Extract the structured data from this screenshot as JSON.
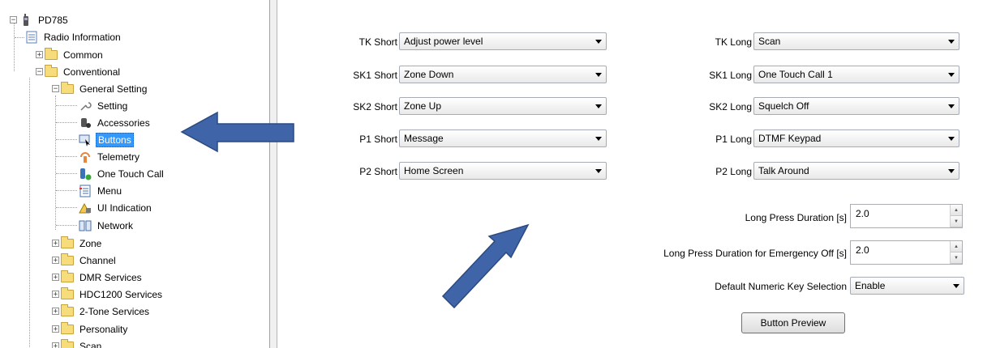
{
  "tree": {
    "root": "PD785",
    "items": [
      {
        "label": "Radio Information",
        "icon": "document-icon"
      },
      {
        "label": "Common",
        "icon": "folder-icon"
      },
      {
        "label": "Conventional",
        "icon": "folder-icon"
      },
      {
        "label": "General Setting",
        "icon": "folder-icon"
      },
      {
        "label": "Setting",
        "icon": "wrench-icon"
      },
      {
        "label": "Accessories",
        "icon": "accessories-icon"
      },
      {
        "label": "Buttons",
        "icon": "buttons-icon",
        "selected": true
      },
      {
        "label": "Telemetry",
        "icon": "telemetry-icon"
      },
      {
        "label": "One Touch Call",
        "icon": "phone-icon"
      },
      {
        "label": "Menu",
        "icon": "menu-icon"
      },
      {
        "label": "UI Indication",
        "icon": "ui-indication-icon"
      },
      {
        "label": "Network",
        "icon": "network-icon"
      },
      {
        "label": "Zone",
        "icon": "folder-icon"
      },
      {
        "label": "Channel",
        "icon": "folder-icon"
      },
      {
        "label": "DMR Services",
        "icon": "folder-icon"
      },
      {
        "label": "HDC1200 Services",
        "icon": "folder-icon"
      },
      {
        "label": "2-Tone Services",
        "icon": "folder-icon"
      },
      {
        "label": "Personality",
        "icon": "folder-icon"
      },
      {
        "label": "Scan",
        "icon": "folder-icon"
      }
    ]
  },
  "form": {
    "short_keys": [
      {
        "label": "TK Short",
        "value": "Adjust power level"
      },
      {
        "label": "SK1 Short",
        "value": "Zone Down"
      },
      {
        "label": "SK2 Short",
        "value": "Zone Up"
      },
      {
        "label": "P1 Short",
        "value": "Message"
      },
      {
        "label": "P2 Short",
        "value": "Home Screen"
      }
    ],
    "long_keys": [
      {
        "label": "TK Long",
        "value": "Scan"
      },
      {
        "label": "SK1 Long",
        "value": "One Touch Call 1"
      },
      {
        "label": "SK2 Long",
        "value": "Squelch Off"
      },
      {
        "label": "P1 Long",
        "value": "DTMF Keypad"
      },
      {
        "label": "P2 Long",
        "value": "Talk Around"
      }
    ],
    "long_press_duration": {
      "label": "Long Press Duration [s]",
      "value": "2.0"
    },
    "long_press_emergency": {
      "label": "Long Press Duration for Emergency Off [s]",
      "value": "2.0"
    },
    "default_numeric_key": {
      "label": "Default Numeric Key Selection",
      "value": "Enable"
    },
    "preview_button": "Button Preview"
  },
  "colors": {
    "selection": "#3399ff",
    "arrow_annotation": "#3f64a8",
    "folder": "#f7dc7b"
  }
}
